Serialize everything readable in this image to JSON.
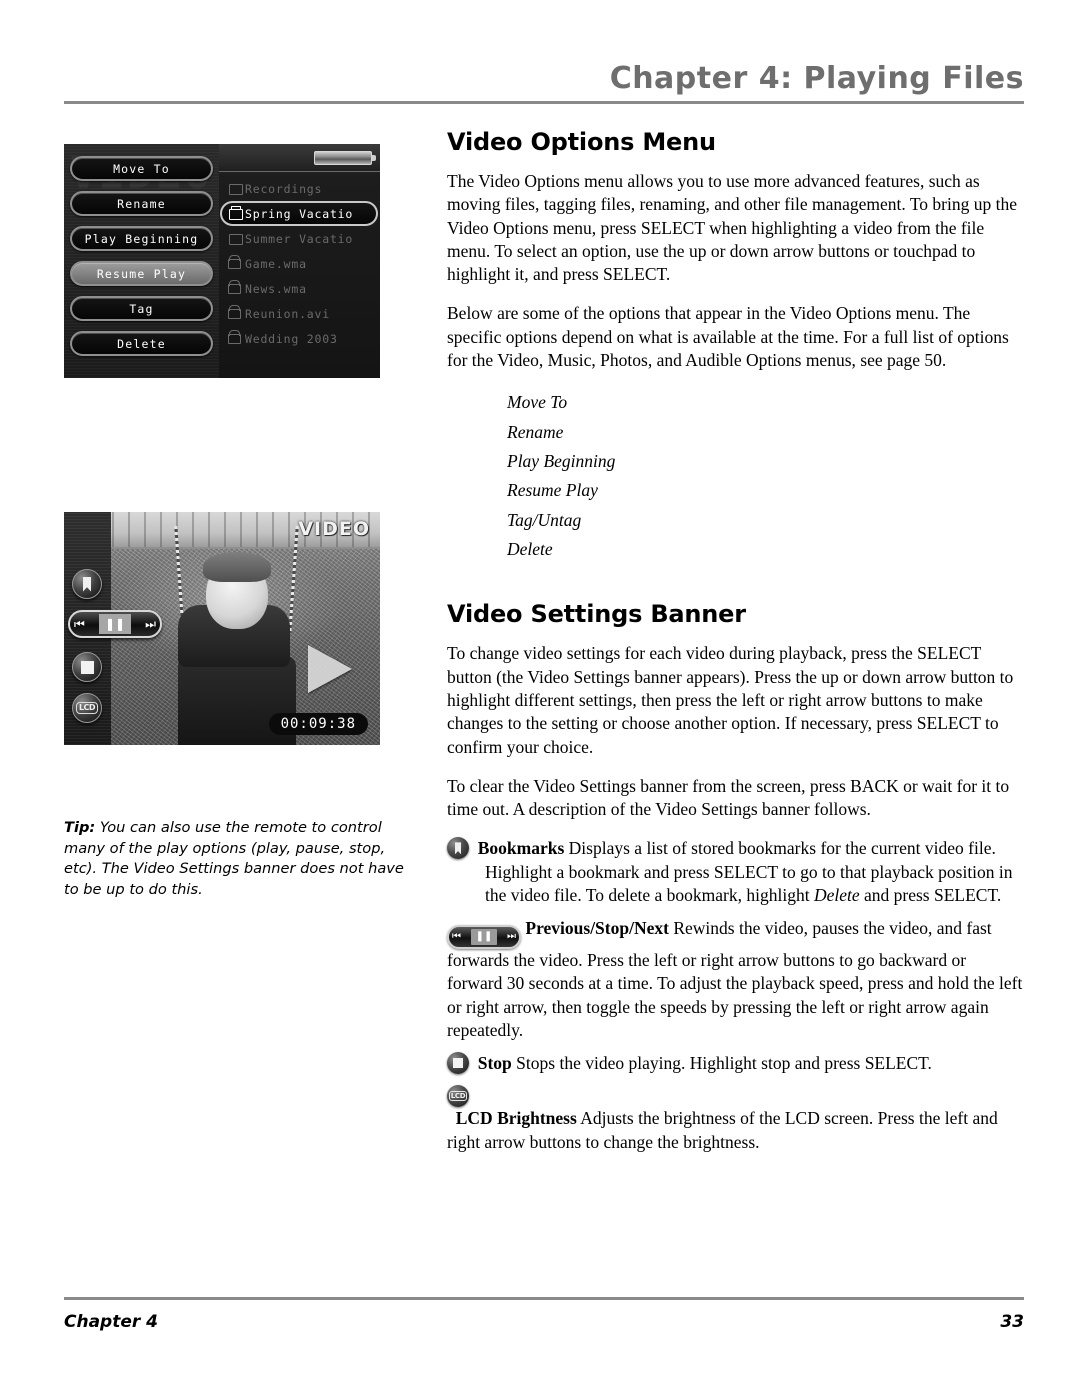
{
  "header": {
    "chapter_title": "Chapter 4: Playing Files"
  },
  "sections": {
    "video_options": {
      "heading": "Video Options Menu",
      "paragraph_1": "The Video Options menu allows you to use more advanced features, such as moving files, tagging files, renaming, and other file management. To bring up the Video Options menu, press SELECT when highlighting a video from the file menu. To select an option, use the up or down arrow buttons or touchpad to highlight it, and press SELECT.",
      "paragraph_2": "Below are some of the options that appear in the Video Options menu. The specific options depend on what is available at the time. For a full list of options for the Video, Music, Photos, and Audible Options menus, see page 50.",
      "options": [
        "Move To",
        "Rename",
        "Play Beginning",
        "Resume Play",
        "Tag/Untag",
        "Delete"
      ]
    },
    "video_settings": {
      "heading": "Video Settings Banner",
      "paragraph_1": "To change video settings for each video during playback, press the SELECT button (the Video Settings banner appears). Press the up or down arrow button to highlight different settings, then press the left or right arrow buttons to make changes to the setting or choose another option. If necessary, press SELECT to confirm your choice.",
      "paragraph_2": "To clear the Video Settings banner from the screen, press BACK or wait for it to time out. A description of the Video Settings banner follows.",
      "items": [
        {
          "icon": "bookmarks-icon",
          "term": "Bookmarks",
          "text_before_italic": " Displays a list of stored bookmarks for the current video file. Highlight a bookmark and press SELECT to go to that playback position in the video file. To delete a bookmark, highlight ",
          "italic_word": "Delete",
          "text_after_italic": " and press SELECT."
        },
        {
          "icon": "previous-stop-next-icon",
          "term": "Previous/Stop/Next",
          "text": " Rewinds the video, pauses the video, and fast forwards the video. Press the left or right arrow buttons to go backward or forward 30 seconds at a time. To adjust the playback speed, press and hold the left or right arrow, then toggle the speeds by pressing the left or right arrow again repeatedly."
        },
        {
          "icon": "stop-icon",
          "term": "Stop",
          "text": " Stops the video playing. Highlight stop and press SELECT."
        },
        {
          "icon": "lcd-brightness-icon",
          "term": "LCD Brightness",
          "text": " Adjusts the brightness of the LCD screen. Press the left and right arrow buttons to change the brightness."
        }
      ]
    }
  },
  "figure_options_menu": {
    "watermark": "VIDEO",
    "menu_buttons": [
      {
        "label": "Move To",
        "selected": false
      },
      {
        "label": "Rename",
        "selected": false
      },
      {
        "label": "Play Beginning",
        "selected": false
      },
      {
        "label": "Resume Play",
        "selected": true
      },
      {
        "label": "Tag",
        "selected": false
      },
      {
        "label": "Delete",
        "selected": false
      }
    ],
    "file_list": [
      {
        "label": "Recordings",
        "icon": "folder-icon",
        "selected": false
      },
      {
        "label": "Spring Vacatio",
        "icon": "folder-open-icon",
        "selected": true
      },
      {
        "label": "Summer Vacatio",
        "icon": "folder-icon",
        "selected": false
      },
      {
        "label": "Game.wma",
        "icon": "video-camera-icon",
        "selected": false
      },
      {
        "label": "News.wma",
        "icon": "video-camera-icon",
        "selected": false
      },
      {
        "label": "Reunion.avi",
        "icon": "video-camera-icon",
        "selected": false
      },
      {
        "label": "Wedding 2003",
        "icon": "video-camera-icon",
        "selected": false
      }
    ]
  },
  "figure_video_player": {
    "overlay_label": "VIDEO",
    "timecode": "00:09:38",
    "controls": [
      {
        "icon": "bookmarks-icon"
      },
      {
        "icon": "previous-pause-next-icon"
      },
      {
        "icon": "stop-icon"
      },
      {
        "icon": "lcd-brightness-icon"
      }
    ]
  },
  "tip": {
    "label": "Tip:",
    "text": " You can also use the remote to control many of the play options (play, pause, stop, etc). The Video Settings banner does not have to be up to do this."
  },
  "footer": {
    "left": "Chapter 4",
    "page_number": "33"
  }
}
